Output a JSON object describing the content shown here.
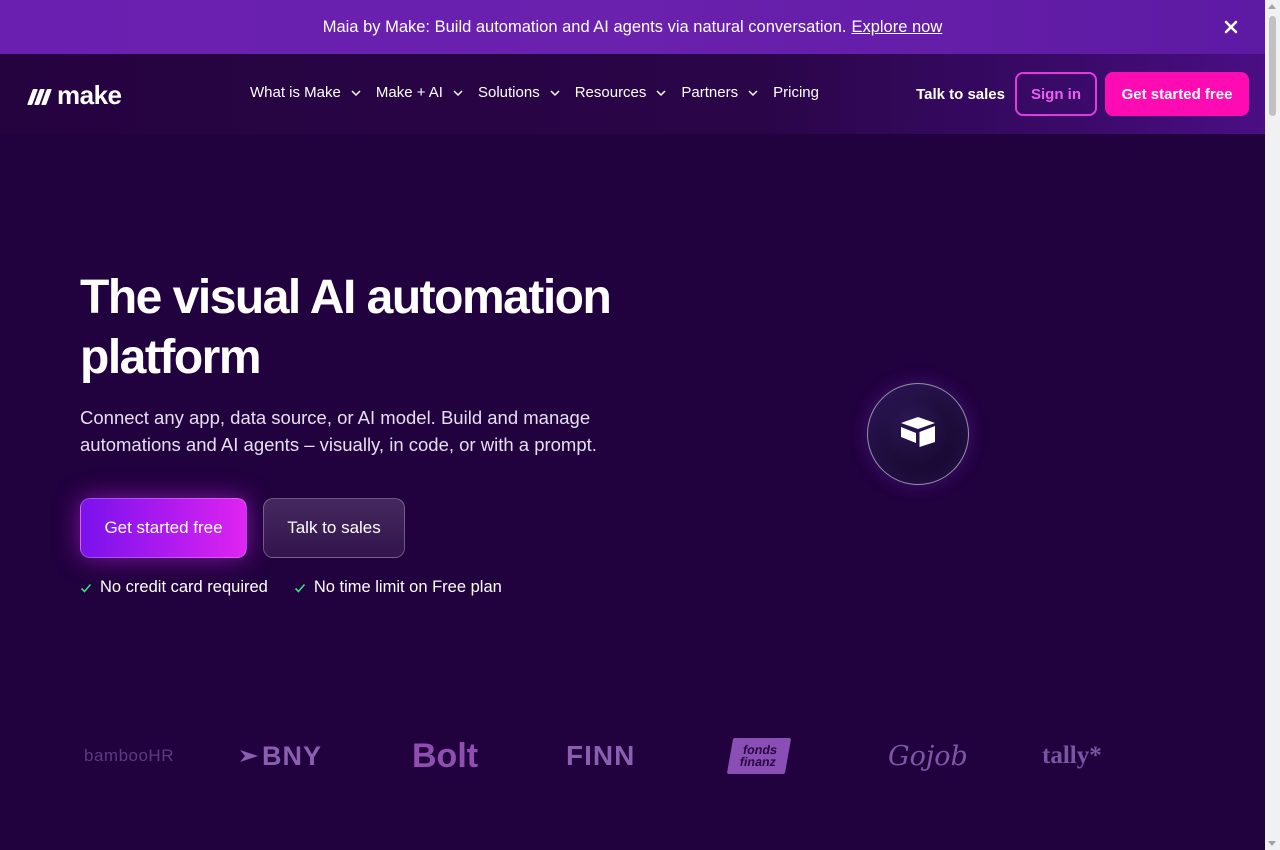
{
  "banner": {
    "text": "Maia by Make: Build automation and AI agents via natural conversation.",
    "link": "Explore now",
    "close_icon": "close-icon"
  },
  "nav": {
    "logo_text": "make",
    "menu": [
      {
        "label": "What is Make",
        "has_dropdown": true
      },
      {
        "label": "Make + AI",
        "has_dropdown": true
      },
      {
        "label": "Solutions",
        "has_dropdown": true
      },
      {
        "label": "Resources",
        "has_dropdown": true
      },
      {
        "label": "Partners",
        "has_dropdown": true
      },
      {
        "label": "Pricing",
        "has_dropdown": false
      }
    ],
    "talk_to_sales": "Talk to sales",
    "sign_in": "Sign in",
    "get_started": "Get started free"
  },
  "hero": {
    "title_line1": "The visual AI automation",
    "title_line2": "platform",
    "subtitle_line1": "Connect any app, data source, or AI model. Build and manage",
    "subtitle_line2": "automations and AI agents – visually, in code, or with a prompt.",
    "primary_button": "Get started free",
    "secondary_button": "Talk to sales",
    "perks": [
      "No credit card required",
      "No time limit on Free plan"
    ],
    "orb_icon": "airtable-cube-icon"
  },
  "logos": [
    "bambooHR",
    "BNY",
    "Bolt",
    "FINN",
    "fonds finanz",
    "Gojob",
    "tally*"
  ],
  "logo_display": {
    "bamboo": "bambooHR",
    "bny": "BNY",
    "bolt": "Bolt",
    "finn": "FINN",
    "fonds_line1": "fonds",
    "fonds_line2": "finanz",
    "gojob": "Gojob",
    "tally": "tally*"
  },
  "colors": {
    "background": "#22013f",
    "banner": "#6a21ad",
    "accent_pink": "#ff0bb3",
    "accent_purple": "#7a12ec",
    "check_green": "#3ddc84"
  }
}
